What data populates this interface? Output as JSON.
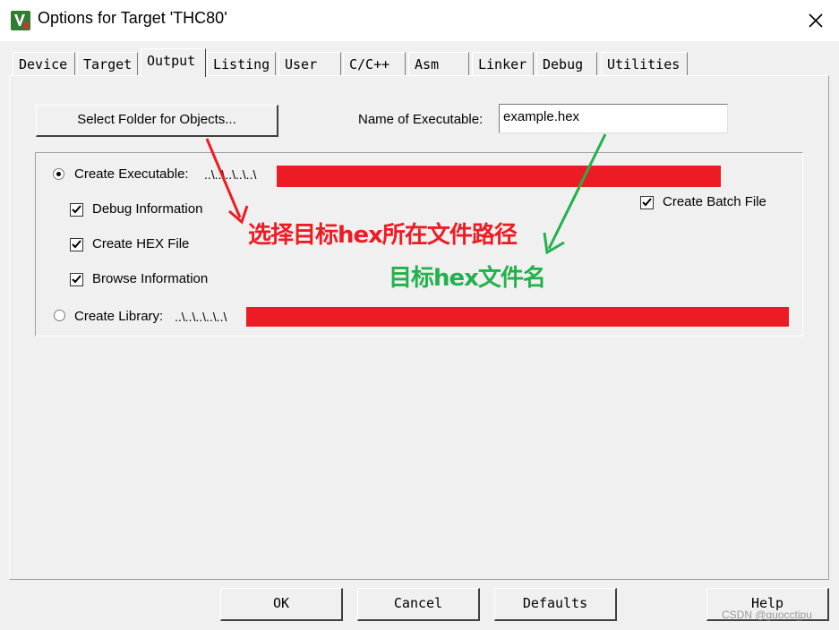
{
  "window": {
    "title": "Options for Target 'THC80'"
  },
  "tabs": [
    {
      "label": "Device"
    },
    {
      "label": "Target"
    },
    {
      "label": "Output"
    },
    {
      "label": "Listing"
    },
    {
      "label": "User"
    },
    {
      "label": "C/C++"
    },
    {
      "label": "Asm"
    },
    {
      "label": "Linker"
    },
    {
      "label": "Debug"
    },
    {
      "label": "Utilities"
    }
  ],
  "output": {
    "select_folder_label": "Select Folder for Objects...",
    "name_of_exe_label": "Name of Executable:",
    "name_of_exe_value": "example.hex",
    "create_executable_label": "Create Executable:",
    "create_executable_path": "..\\..\\..\\..\\..\\",
    "debug_info_label": "Debug Information",
    "create_hex_label": "Create HEX File",
    "browse_info_label": "Browse Information",
    "create_batch_label": "Create Batch File",
    "create_library_label": "Create Library:",
    "create_library_path": "..\\..\\..\\..\\..\\"
  },
  "annotations": {
    "red_text": "选择目标hex所在文件路径",
    "green_text": "目标hex文件名"
  },
  "buttons": {
    "ok": "OK",
    "cancel": "Cancel",
    "defaults": "Defaults",
    "help": "Help"
  },
  "watermark": "CSDN @guocctjpu",
  "colors": {
    "redaction": "#ed1c24",
    "annotation_red": "#ed1c24",
    "annotation_green": "#22b14c"
  }
}
